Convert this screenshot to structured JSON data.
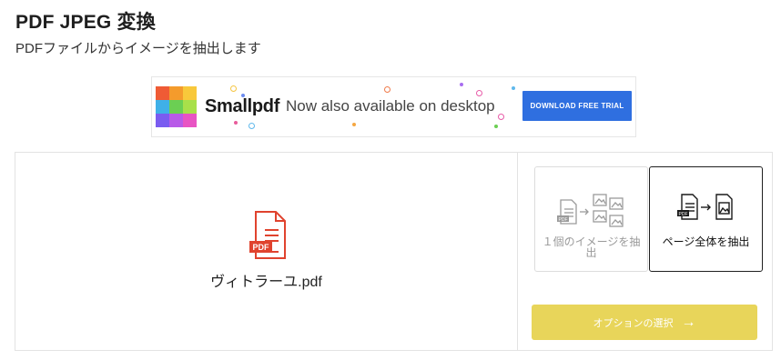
{
  "page": {
    "title": "PDF JPEG 変換",
    "subtitle": "PDFファイルからイメージを抽出します"
  },
  "banner": {
    "brand": "Smallpdf",
    "tagline": "Now also available on desktop",
    "cta_label": "DOWNLOAD FREE TRIAL",
    "colors": {
      "cta": "#2f6fe0",
      "logo": [
        "#ef5b35",
        "#f49b2c",
        "#f8c83b",
        "#3fb0e8",
        "#6bcf53",
        "#a8e04a",
        "#7a5cf0",
        "#b85ae8",
        "#e854c3"
      ]
    }
  },
  "file": {
    "badge": "PDF",
    "name": "ヴィトラーユ.pdf",
    "icon": "pdf-file-icon",
    "color": "#e0432e"
  },
  "options": [
    {
      "label": "１個のイメージを抽出",
      "icon": "extract-single-images-icon",
      "selected": false
    },
    {
      "label": "ページ全体を抽出",
      "icon": "convert-full-page-icon",
      "selected": true
    }
  ],
  "action": {
    "label": "オプションの選択",
    "icon": "arrow-right-icon",
    "color": "#e8d55a"
  }
}
